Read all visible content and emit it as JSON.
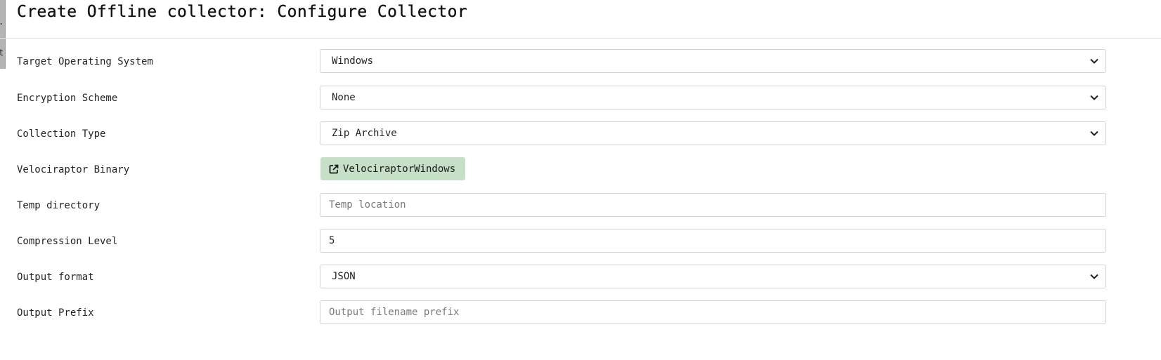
{
  "page": {
    "title": "Create Offline collector: Configure Collector"
  },
  "left_strip": {
    "frag1": ".",
    "frag2": "t"
  },
  "form": {
    "target_os": {
      "label": "Target Operating System",
      "value": "Windows"
    },
    "encryption": {
      "label": "Encryption Scheme",
      "value": "None"
    },
    "collection_type": {
      "label": "Collection Type",
      "value": "Zip Archive"
    },
    "binary": {
      "label": "Velociraptor Binary",
      "button_label": "VelociraptorWindows",
      "icon": "external-link-icon"
    },
    "temp_dir": {
      "label": "Temp directory",
      "value": "",
      "placeholder": "Temp location"
    },
    "compression": {
      "label": "Compression Level",
      "value": "5"
    },
    "output_format": {
      "label": "Output format",
      "value": "JSON"
    },
    "output_prefix": {
      "label": "Output Prefix",
      "value": "",
      "placeholder": "Output filename prefix"
    }
  },
  "colors": {
    "binary_button_bg": "#c6e0c8",
    "border": "#ced4da"
  }
}
